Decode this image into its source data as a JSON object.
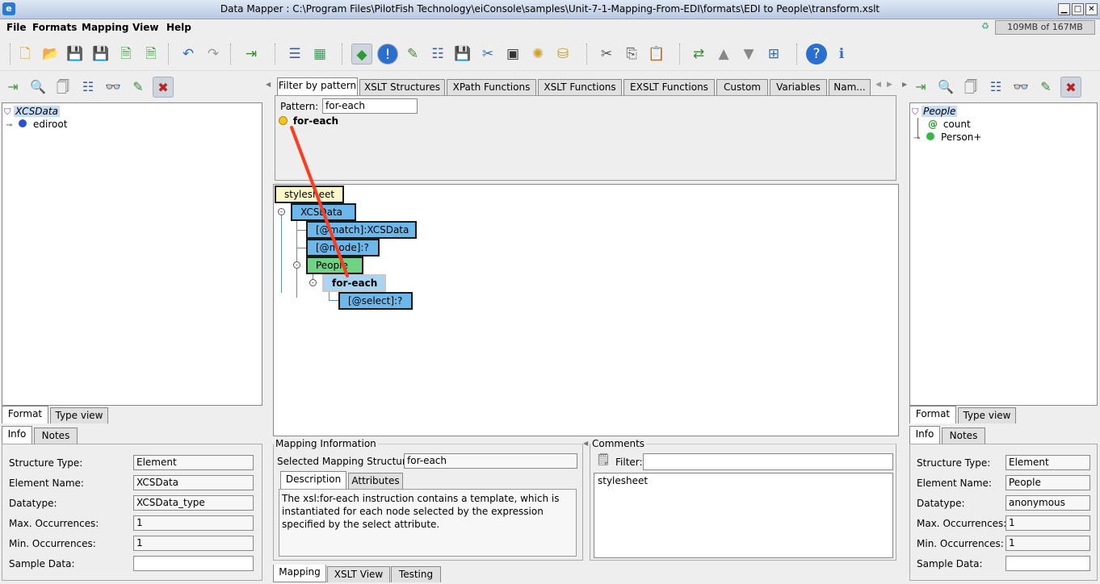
{
  "window": {
    "title": "Data Mapper : C:\\Program Files\\PilotFish Technology\\eiConsole\\samples\\Unit-7-1-Mapping-From-EDI\\formats\\EDI to People\\transform.xslt"
  },
  "menu": [
    "File",
    "Formats",
    "Mapping",
    "View",
    "Help"
  ],
  "memory": "109MB of 167MB",
  "left_tree": {
    "root": "XCSData",
    "child": "ediroot"
  },
  "left_view_tabs": [
    "Format",
    "Type view"
  ],
  "left_info_tabs": [
    "Info",
    "Notes"
  ],
  "left_info": {
    "labels": [
      "Structure Type:",
      "Element Name:",
      "Datatype:",
      "Max. Occurrences:",
      "Min. Occurrences:",
      "Sample Data:"
    ],
    "values": [
      "Element",
      "XCSData",
      "XCSData_type",
      "1",
      "1",
      ""
    ]
  },
  "palette_tabs": [
    "Filter by pattern",
    "XSLT Structures",
    "XPath Functions",
    "XSLT Functions",
    "EXSLT Functions",
    "Custom",
    "Variables",
    "Nam..."
  ],
  "pattern": {
    "label": "Pattern:",
    "value": "for-each",
    "result": "for-each"
  },
  "mapping_tree": {
    "stylesheet": "stylesheet",
    "xcsdata": "XCSData",
    "match": "[@match]:XCSData",
    "mode": "[@mode]:?",
    "people": "People",
    "foreach": "for-each",
    "select": "[@select]:?"
  },
  "mapping_info": {
    "legend": "Mapping Information",
    "selected_label": "Selected Mapping Structure:",
    "selected_value": "for-each",
    "tabs": [
      "Description",
      "Attributes"
    ],
    "description": "The xsl:for-each instruction contains a template, which is instantiated for each node selected by the expression specified by the select attribute."
  },
  "comments": {
    "legend": "Comments",
    "filter_label": "Filter:",
    "filter_value": "",
    "text": "stylesheet"
  },
  "bottom_tabs": [
    "Mapping",
    "XSLT View",
    "Testing"
  ],
  "right_tree": {
    "root": "People",
    "attr": "count",
    "child": "Person+"
  },
  "right_view_tabs": [
    "Format",
    "Type view"
  ],
  "right_info_tabs": [
    "Info",
    "Notes"
  ],
  "right_info": {
    "labels": [
      "Structure Type:",
      "Element Name:",
      "Datatype:",
      "Max. Occurrences:",
      "Min. Occurrences:",
      "Sample Data:"
    ],
    "values": [
      "Element",
      "People",
      "anonymous",
      "1",
      "1",
      ""
    ]
  },
  "colors": {
    "accent_blue": "#6cb8ec",
    "accent_green": "#6ed483",
    "link_line": "#ff3b1f",
    "stylesheet_node": "#fbf7c8"
  }
}
